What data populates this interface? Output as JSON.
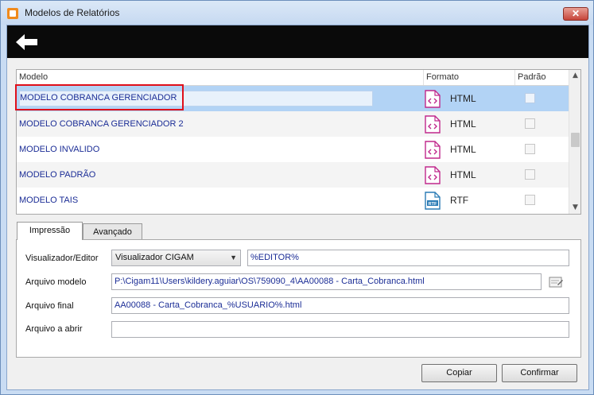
{
  "window": {
    "title": "Modelos de Relatórios",
    "close_label": "✕"
  },
  "toolbar": {
    "back_icon": "back-arrow-icon"
  },
  "grid": {
    "columns": [
      "Modelo",
      "Formato",
      "Padrão"
    ],
    "rows": [
      {
        "name": "MODELO COBRANCA GERENCIADOR",
        "format": "HTML",
        "icon": "html-file-icon",
        "default": false,
        "selected": true
      },
      {
        "name": "MODELO COBRANCA GERENCIADOR 2",
        "format": "HTML",
        "icon": "html-file-icon",
        "default": false,
        "selected": false
      },
      {
        "name": "MODELO INVALIDO",
        "format": "HTML",
        "icon": "html-file-icon",
        "default": false,
        "selected": false
      },
      {
        "name": "MODELO PADRÃO",
        "format": "HTML",
        "icon": "html-file-icon",
        "default": false,
        "selected": false
      },
      {
        "name": "MODELO TAIS",
        "format": "RTF",
        "icon": "rtf-file-icon",
        "default": false,
        "selected": false
      }
    ],
    "rtf_badge": "RTF"
  },
  "tabs": [
    {
      "label": "Impressão",
      "active": true
    },
    {
      "label": "Avançado",
      "active": false
    }
  ],
  "form": {
    "viewer_label": "Visualizador/Editor",
    "viewer_value": "Visualizador CIGAM",
    "viewer_param": "%EDITOR%",
    "model_file_label": "Arquivo modelo",
    "model_file_value": "P:\\Cigam11\\Users\\kildery.aguiar\\OS\\759090_4\\AA00088 - Carta_Cobranca.html",
    "final_file_label": "Arquivo final",
    "final_file_value": "AA00088 - Carta_Cobranca_%USUARIO%.html",
    "open_file_label": "Arquivo a abrir",
    "open_file_value": ""
  },
  "buttons": {
    "copy": "Copiar",
    "confirm": "Confirmar"
  },
  "colors": {
    "selected_row": "#b2d3f5",
    "highlight_box": "#e0101a",
    "html_icon": "#c0288c",
    "rtf_icon": "#2a7bb5",
    "link_text": "#1b2d96"
  }
}
